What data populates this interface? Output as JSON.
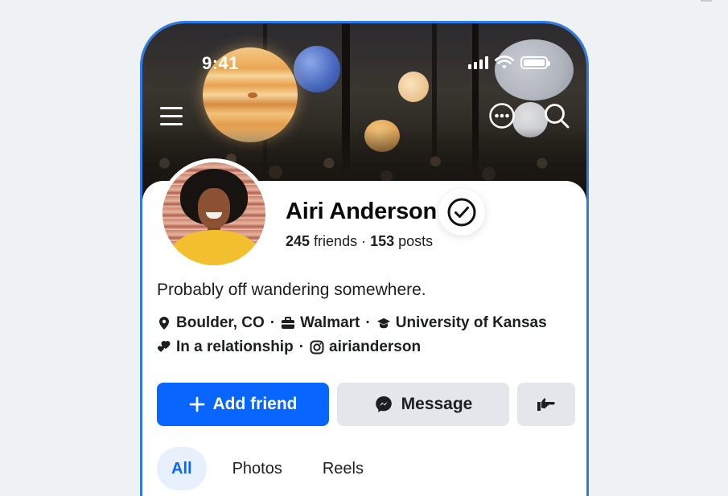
{
  "status_bar": {
    "time": "9:41"
  },
  "header": {
    "menu_icon": "hamburger-icon",
    "more_icon": "more-horizontal-icon",
    "search_icon": "search-icon"
  },
  "profile": {
    "name": "Airi Anderson",
    "verified_icon": "check-circle-icon",
    "friends_count": "245",
    "friends_label": " friends · ",
    "posts_count": "153",
    "posts_label": " posts",
    "bio": "Probably off wandering somewhere.",
    "details_line1": [
      {
        "icon": "location-pin-icon",
        "text": "Boulder, CO"
      },
      {
        "icon": "briefcase-icon",
        "text": "Walmart"
      },
      {
        "icon": "graduation-cap-icon",
        "text": "University of Kansas"
      }
    ],
    "details_line2": [
      {
        "icon": "hearts-icon",
        "text": "In a relationship"
      },
      {
        "icon": "instagram-icon",
        "text": "airianderson"
      }
    ],
    "separator": "·"
  },
  "actions": {
    "add_friend": "Add friend",
    "message": "Message",
    "poke_icon": "poke-hand-icon"
  },
  "tabs": [
    {
      "label": "All",
      "active": true
    },
    {
      "label": "Photos",
      "active": false
    },
    {
      "label": "Reels",
      "active": false
    }
  ],
  "colors": {
    "accent": "#0866ff",
    "phone_border": "#2e7be6",
    "button_gray": "#e4e6eb",
    "tab_active_bg": "#e7f0fc"
  }
}
